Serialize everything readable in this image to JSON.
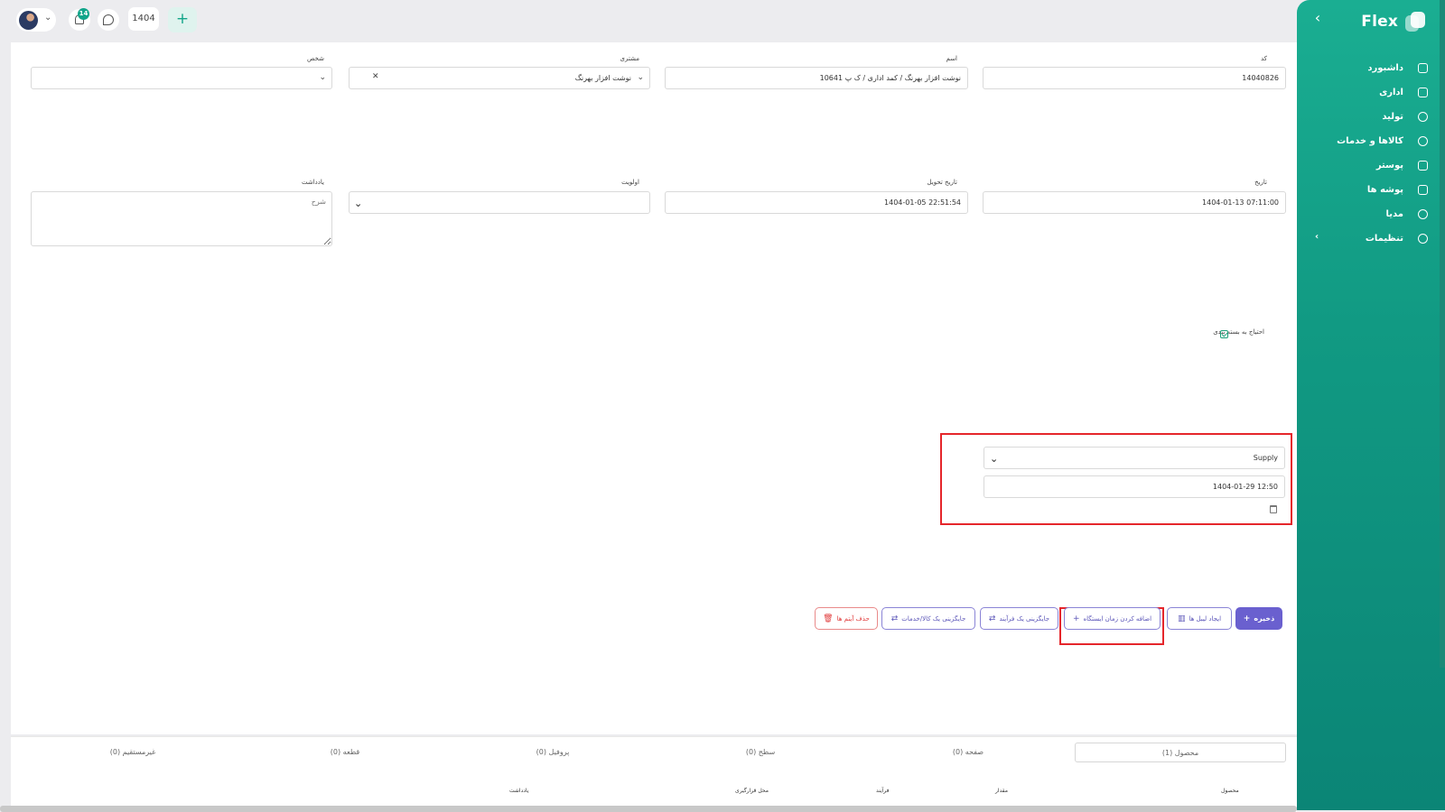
{
  "app": {
    "brand": "Flex",
    "collapse_icon": "chevron-left-icon"
  },
  "sidebar": {
    "items": [
      {
        "label": "داشبورد",
        "icon": "home-icon"
      },
      {
        "label": "اداری",
        "icon": "briefcase-icon"
      },
      {
        "label": "تولید",
        "icon": "factory-icon"
      },
      {
        "label": "کالاها و خدمات",
        "icon": "box-icon"
      },
      {
        "label": "پوستر",
        "icon": "image-icon"
      },
      {
        "label": "پوشه ها",
        "icon": "folder-icon"
      },
      {
        "label": "مدیا",
        "icon": "media-icon"
      },
      {
        "label": "تنظیمات",
        "icon": "gear-icon",
        "has_submenu": true
      }
    ]
  },
  "topbar": {
    "notifications_count": "14",
    "year": "1404",
    "add_symbol": "+"
  },
  "form": {
    "code_label": "کد",
    "code_value": "14040826",
    "name_label": "اسم",
    "name_value": "نوشت افزار بهرنگ / کمد اداری / ک پ 10641",
    "customer_label": "مشتری",
    "customer_value": "نوشت افزار بهرنگ",
    "person_label": "شخص",
    "person_value": "",
    "date_label": "تاریخ",
    "date_value": "1404-01-13 07:11:00",
    "delivery_label": "تاریخ تحویل",
    "delivery_value": "1404-01-05 22:51:54",
    "priority_label": "اولویت",
    "priority_value": "",
    "notes_label": "یادداشت",
    "notes_placeholder": "شرح",
    "packaging_label": "احتیاج به بسته بندی",
    "packaging_checked": true
  },
  "station": {
    "type_value": "Supply",
    "datetime_value": "1404-01-29 12:50"
  },
  "actions": {
    "save": "ذخیره",
    "create_labels": "ایجاد لیبل ها",
    "add_station_time": "اضافه کردن زمان ایستگاه",
    "replace_process": "جایگزینی یک فرآیند",
    "replace_product": "جایگزینی یک کالا/خدمات",
    "delete_items": "حذف آیتم ها"
  },
  "tabs": [
    {
      "label": "محصول (1)",
      "active": true
    },
    {
      "label": "صفحه (0)"
    },
    {
      "label": "سطح (0)"
    },
    {
      "label": "پروفیل (0)"
    },
    {
      "label": "قطعه (0)"
    },
    {
      "label": "غیرمستقیم (0)"
    }
  ],
  "table": {
    "headers": [
      "محصول",
      "مقدار",
      "فرآیند",
      "محل قرارگیری",
      "یادداشت"
    ]
  },
  "colors": {
    "sidebar": "#11a58a",
    "primary_button": "#6a60cf",
    "highlight_frame": "#e5262b"
  }
}
